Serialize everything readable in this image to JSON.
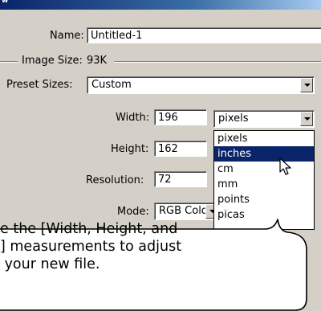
{
  "dialog": {
    "name_label": "Name:",
    "name_value": "Untitled-1",
    "image_size_label": "Image Size:",
    "image_size_value": "93K",
    "preset_label": "Preset Sizes:",
    "preset_value": "Custom",
    "width_label": "Width:",
    "width_value": "196",
    "width_unit": "pixels",
    "height_label": "Height:",
    "height_value": "162",
    "resolution_label": "Resolution:",
    "resolution_value": "72",
    "mode_label": "Mode:",
    "mode_value": "RGB Color"
  },
  "unit_dropdown": {
    "options": [
      "pixels",
      "inches",
      "cm",
      "mm",
      "points",
      "picas"
    ],
    "highlighted": "inches"
  },
  "callout": {
    "line1": "e the [Width, Height, and",
    "line2": "] measurements to adjust",
    "line3": " your new file."
  },
  "colors": {
    "dialog_bg": "#d4d0c8",
    "selection": "#0a246a",
    "titlebar": "#0a246a"
  }
}
